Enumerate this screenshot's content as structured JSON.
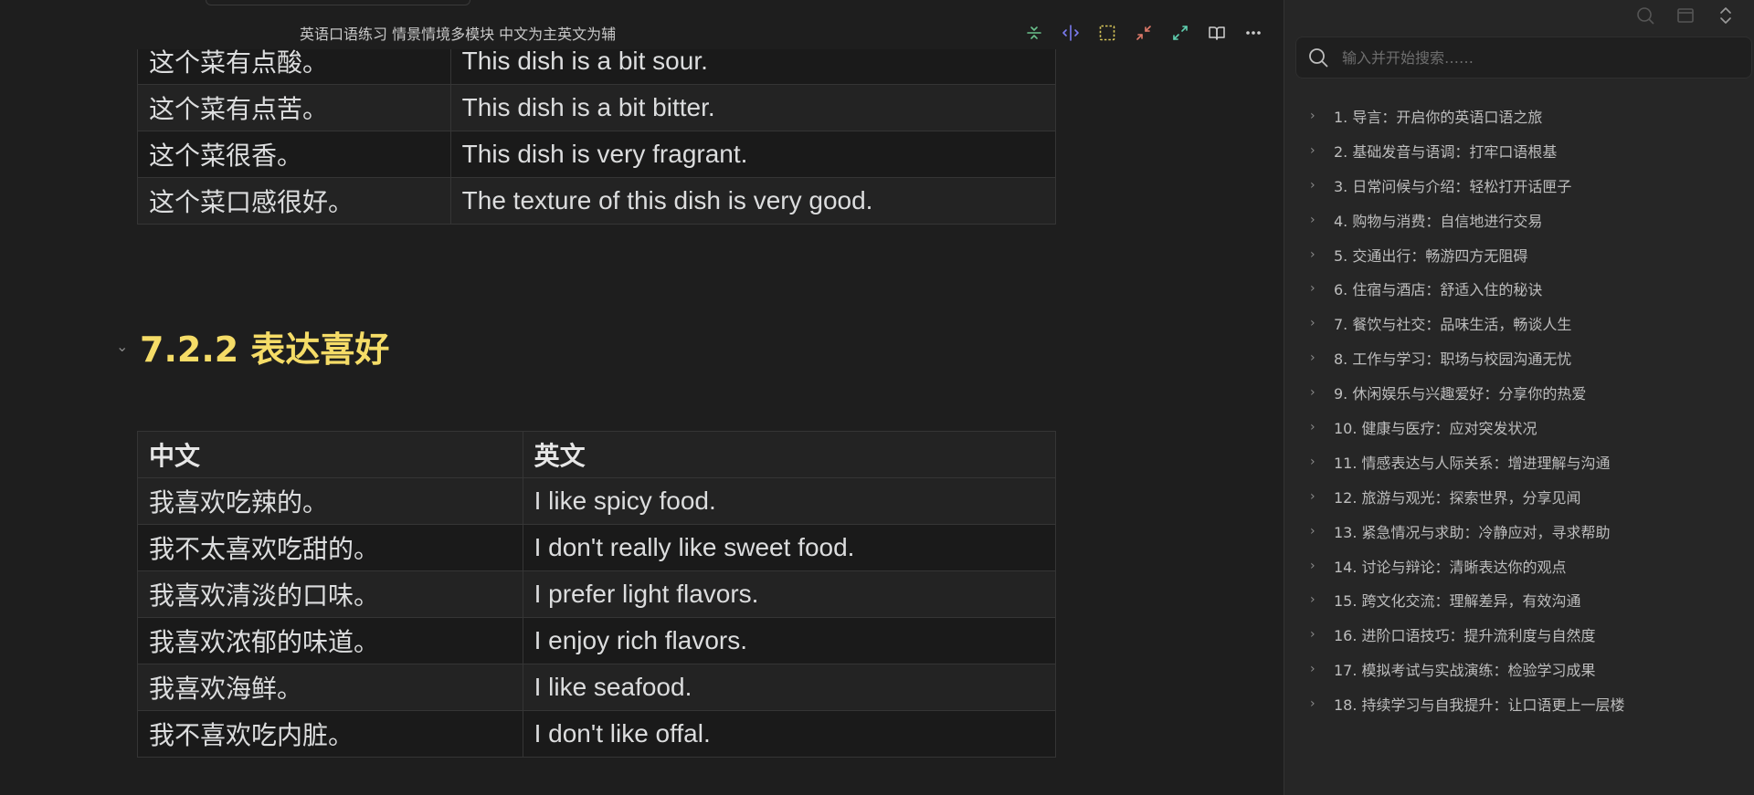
{
  "header": {
    "doc_title": "英语口语练习 情景情境多模块 中文为主英文为辅"
  },
  "toolbar_icons": [
    "collapse-icon",
    "split-icon",
    "select-icon",
    "minimize-icon",
    "expand-icon",
    "reading-mode-icon",
    "more-icon"
  ],
  "colors": {
    "heading": "#f5dc67",
    "icon_green": "#6ac08c",
    "icon_blue": "#7b7bf0",
    "icon_yellow": "#d8c65a",
    "icon_red": "#e07a6a",
    "icon_teal": "#5fd0b0"
  },
  "table_top": {
    "rows": [
      {
        "zh": "这个菜有点酸。",
        "en": "This dish is a bit sour."
      },
      {
        "zh": "这个菜有点苦。",
        "en": "This dish is a bit bitter."
      },
      {
        "zh": "这个菜很香。",
        "en": "This dish is very fragrant."
      },
      {
        "zh": "这个菜口感很好。",
        "en": "The texture of this dish is very good."
      }
    ]
  },
  "section": {
    "heading": "7.2.2 表达喜好"
  },
  "table_bottom": {
    "headers": [
      "中文",
      "英文"
    ],
    "rows": [
      {
        "zh": "我喜欢吃辣的。",
        "en": "I like spicy food."
      },
      {
        "zh": "我不太喜欢吃甜的。",
        "en": "I don't really like sweet food."
      },
      {
        "zh": "我喜欢清淡的口味。",
        "en": "I prefer light flavors."
      },
      {
        "zh": "我喜欢浓郁的味道。",
        "en": "I enjoy rich flavors."
      },
      {
        "zh": "我喜欢海鲜。",
        "en": "I like seafood."
      },
      {
        "zh": "我不喜欢吃内脏。",
        "en": "I don't like offal."
      }
    ]
  },
  "sidebar": {
    "search_placeholder": "输入并开始搜索……",
    "outline": [
      "1. 导言：开启你的英语口语之旅",
      "2. 基础发音与语调：打牢口语根基",
      "3. 日常问候与介绍：轻松打开话匣子",
      "4. 购物与消费：自信地进行交易",
      "5. 交通出行：畅游四方无阻碍",
      "6. 住宿与酒店：舒适入住的秘诀",
      "7. 餐饮与社交：品味生活，畅谈人生",
      "8. 工作与学习：职场与校园沟通无忧",
      "9. 休闲娱乐与兴趣爱好：分享你的热爱",
      "10. 健康与医疗：应对突发状况",
      "11. 情感表达与人际关系：增进理解与沟通",
      "12. 旅游与观光：探索世界，分享见闻",
      "13. 紧急情况与求助：冷静应对，寻求帮助",
      "14. 讨论与辩论：清晰表达你的观点",
      "15. 跨文化交流：理解差异，有效沟通",
      "16. 进阶口语技巧：提升流利度与自然度",
      "17. 模拟考试与实战演练：检验学习成果",
      "18. 持续学习与自我提升：让口语更上一层楼"
    ]
  }
}
